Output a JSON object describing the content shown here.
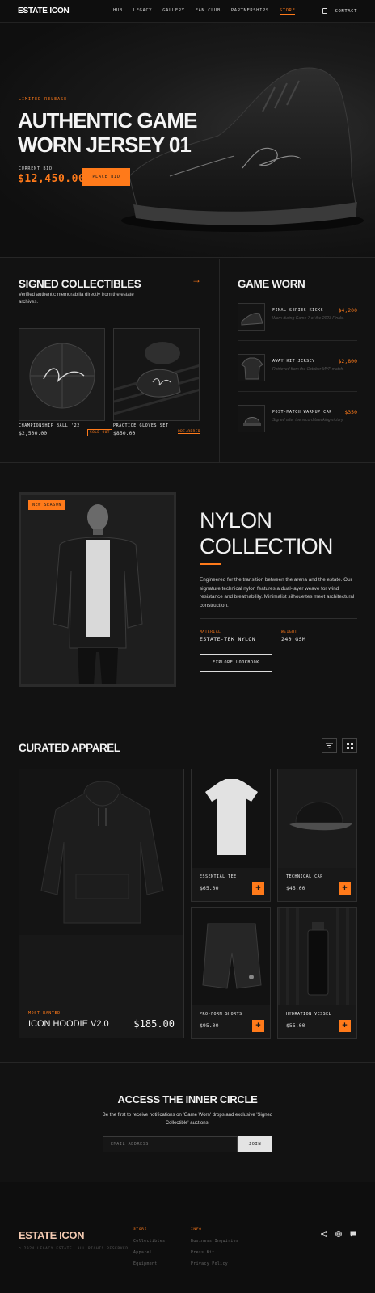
{
  "nav": {
    "logo": "ESTATE ICON",
    "links": [
      "HUB",
      "LEGACY",
      "GALLERY",
      "FAN CLUB",
      "PARTNERSHIPS",
      "STORE"
    ],
    "active": "STORE",
    "contact": "CONTACT"
  },
  "hero": {
    "tag": "LIMITED RELEASE",
    "title": "AUTHENTIC GAME WORN JERSEY 01",
    "bid_label": "CURRENT BID",
    "bid_value": "$12,450.00",
    "cta": "PLACE BID"
  },
  "signed": {
    "title": "SIGNED COLLECTIBLES",
    "subtitle": "Verified authentic memorabilia directly from the estate archives.",
    "items": [
      {
        "name": "CHAMPIONSHIP BALL '22",
        "price": "$2,500.00",
        "status": "SOLD OUT"
      },
      {
        "name": "PRACTICE GLOVES SET",
        "price": "$850.00",
        "status": "PRE-ORDER"
      }
    ]
  },
  "game_worn": {
    "title": "GAME WORN",
    "items": [
      {
        "name": "FINAL SERIES KICKS",
        "price": "$4,200",
        "desc": "Worn during Game 7 of the 2023 Finals."
      },
      {
        "name": "AWAY KIT JERSEY",
        "price": "$2,800",
        "desc": "Retrieved from the October MVP match."
      },
      {
        "name": "POST-MATCH WARMUP CAP",
        "price": "$350",
        "desc": "Signed after the record-breaking victory."
      }
    ]
  },
  "nylon": {
    "badge": "NEW SEASON",
    "title_line1": "NYLON",
    "title_line2": "COLLECTION",
    "description": "Engineered for the transition between the arena and the estate. Our signature technical nylon features a dual-layer weave for wind resistance and breathability. Minimalist silhouettes meet architectural construction.",
    "material_label": "MATERIAL",
    "material_value": "ESTATE-TEK NYLON",
    "weight_label": "WEIGHT",
    "weight_value": "240 GSM",
    "cta": "EXPLORE LOOKBOOK"
  },
  "apparel": {
    "title": "CURATED APPAREL",
    "featured": {
      "tag": "MOST WANTED",
      "name": "ICON HOODIE V2.0",
      "price": "$185.00"
    },
    "items": [
      {
        "name": "ESSENTIAL TEE",
        "price": "$65.00"
      },
      {
        "name": "TECHNICAL CAP",
        "price": "$45.00"
      },
      {
        "name": "PRO-FORM SHORTS",
        "price": "$95.00"
      },
      {
        "name": "HYDRATION VESSEL",
        "price": "$55.00"
      }
    ],
    "plus": "+"
  },
  "newsletter": {
    "title": "ACCESS THE INNER CIRCLE",
    "subtitle": "Be the first to receive notifications on 'Game Worn' drops and exclusive 'Signed Collectible' auctions.",
    "placeholder": "EMAIL ADDRESS",
    "cta": "JOIN"
  },
  "footer": {
    "logo": "ESTATE ICON",
    "copyright": "© 2024 LEGACY ESTATE. ALL RIGHTS RESERVED.",
    "store_head": "STORE",
    "store_links": [
      "Collectibles",
      "Apparel",
      "Equipment"
    ],
    "info_head": "INFO",
    "info_links": [
      "Business Inquiries",
      "Press Kit",
      "Privacy Policy"
    ]
  },
  "colors": {
    "accent": "#ff7a1a",
    "background": "#121212"
  }
}
